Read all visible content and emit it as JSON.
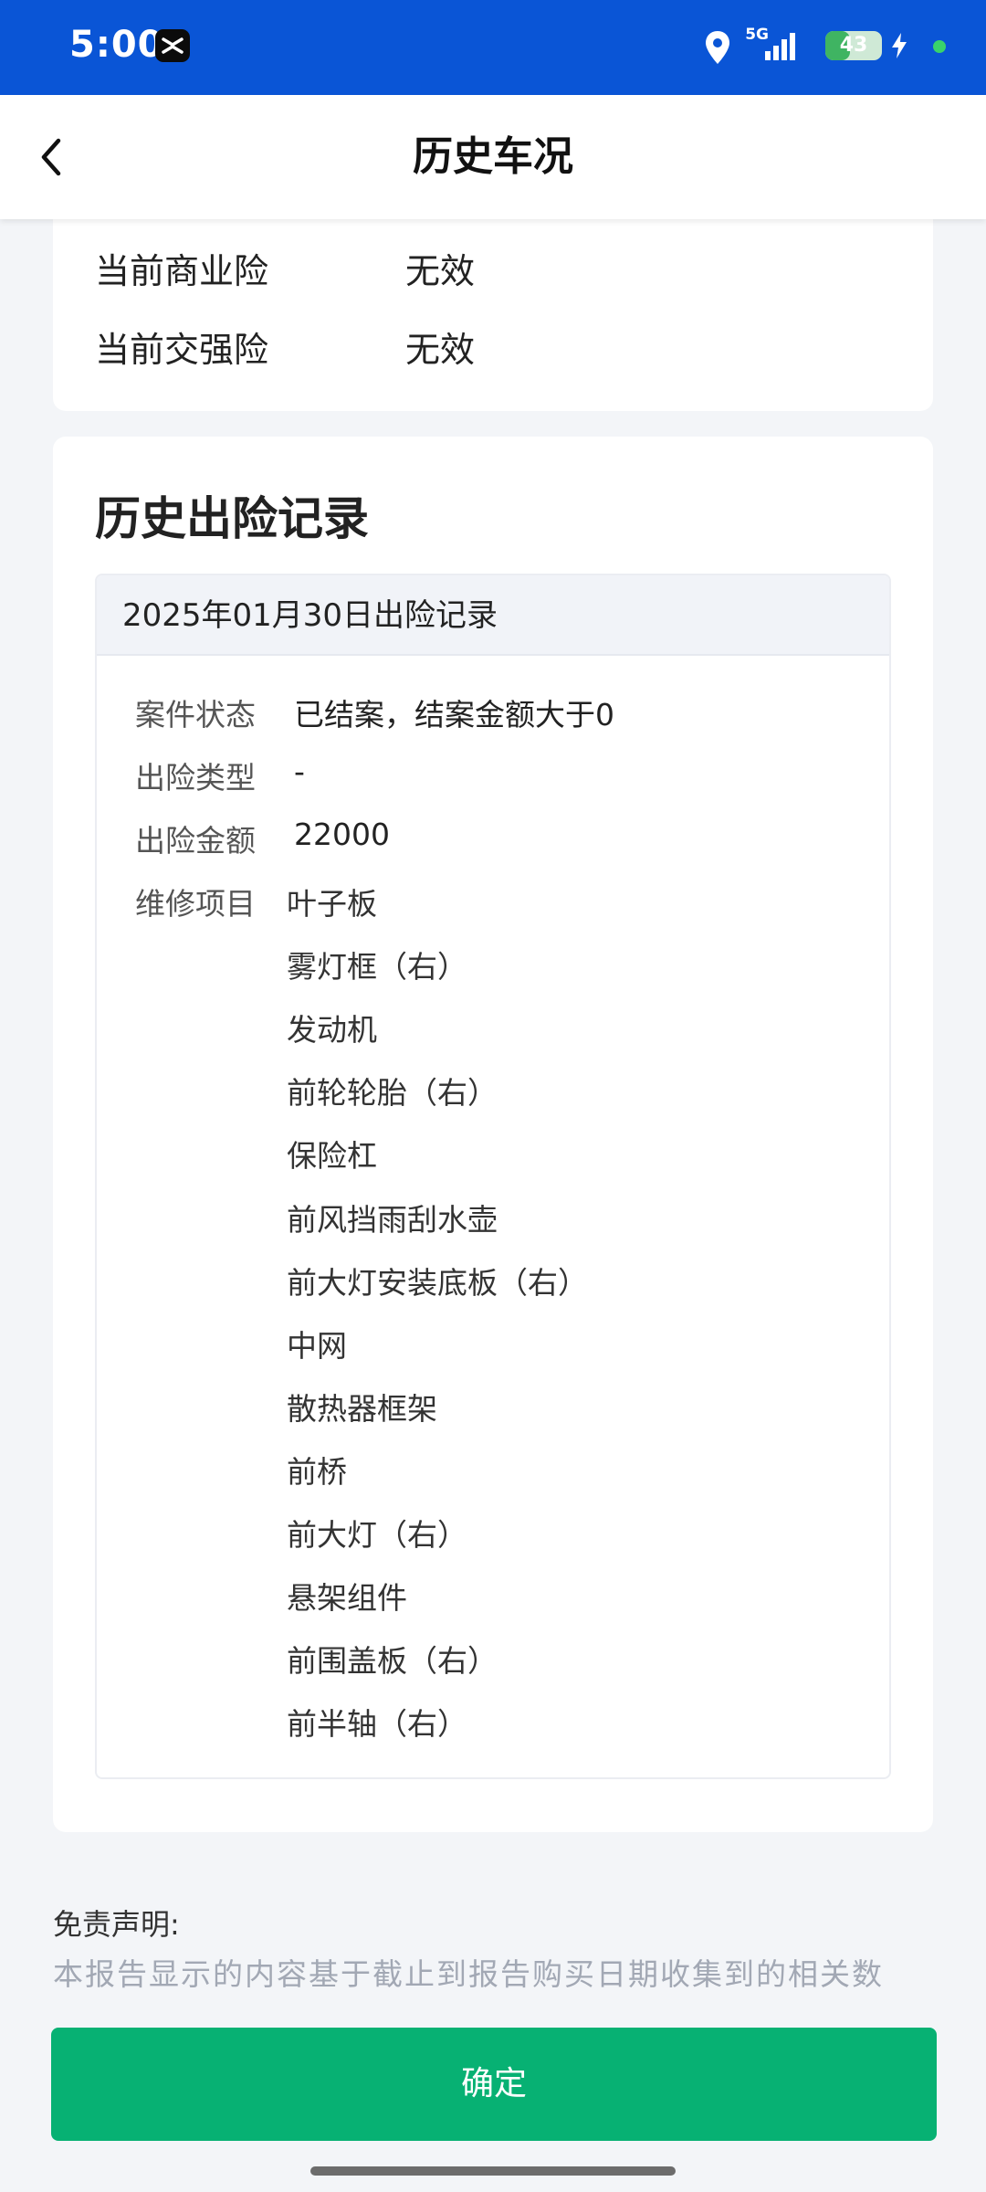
{
  "status_bar": {
    "time": "5:00",
    "network": "5G",
    "battery": "43",
    "battery_fraction": 0.43,
    "icons": [
      "capcut-icon",
      "location-icon",
      "signal-icon",
      "battery-icon",
      "charging-bolt-icon",
      "dot-icon"
    ]
  },
  "header": {
    "title": "历史车况",
    "back_icon": "chevron-left-icon"
  },
  "insurance": {
    "rows": [
      {
        "label": "当前商业险",
        "value": "无效"
      },
      {
        "label": "当前交强险",
        "value": "无效"
      }
    ]
  },
  "claims": {
    "section_title": "历史出险记录",
    "record": {
      "date_title": "2025年01月30日出险记录",
      "fields": [
        {
          "label": "案件状态",
          "value": "已结案，结案金额大于0"
        },
        {
          "label": "出险类型",
          "value": "-"
        },
        {
          "label": "出险金额",
          "value": "22000"
        }
      ],
      "repair_label": "维修项目",
      "repair_items": [
        "叶子板",
        "雾灯框（右）",
        "发动机",
        "前轮轮胎（右）",
        "保险杠",
        "前风挡雨刮水壶",
        "前大灯安装底板（右）",
        "中网",
        "散热器框架",
        "前桥",
        "前大灯（右）",
        "悬架组件",
        "前围盖板（右）",
        "前半轴（右）"
      ]
    }
  },
  "disclaimer": {
    "title": "免责声明:",
    "body": "本报告显示的内容基于截止到报告购买日期收集到的相关数据，所有数据均来自第三方，由于部分数据无法被采集，我们"
  },
  "footer": {
    "confirm_label": "确定"
  },
  "colors": {
    "status_bar": "#0a55d6",
    "confirm": "#07b173",
    "background": "#f3f5f8",
    "muted_text": "#a2a8b4"
  }
}
